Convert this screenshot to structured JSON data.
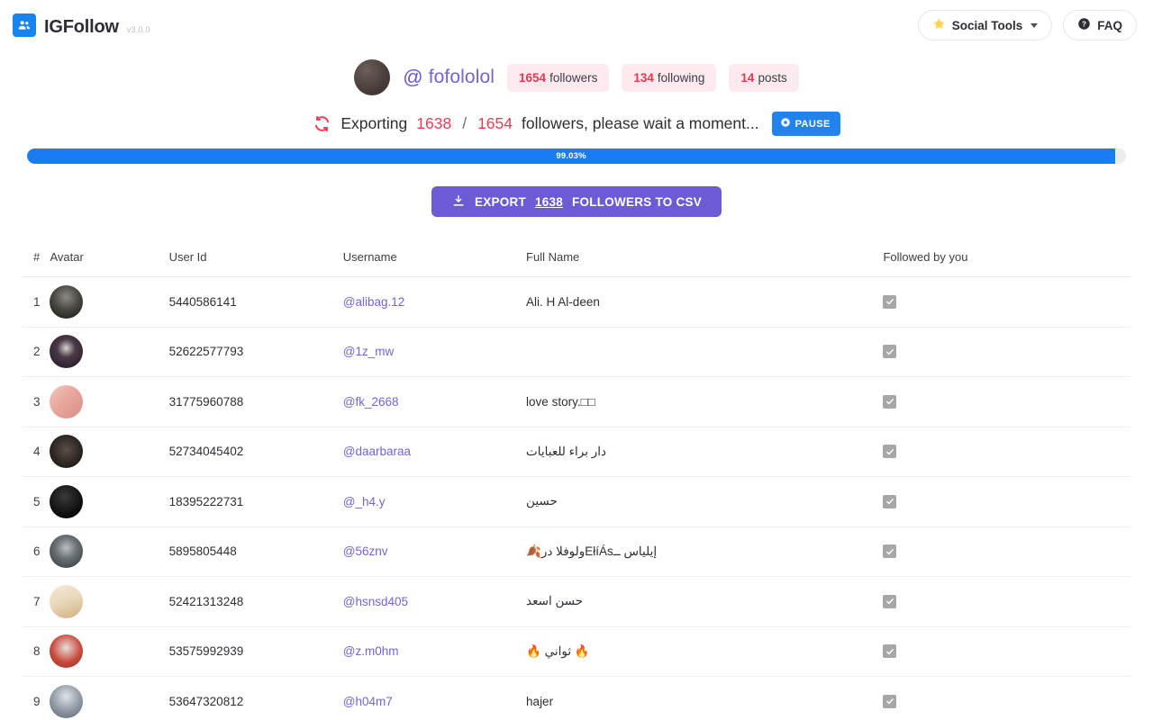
{
  "header": {
    "brand_name": "IGFollow",
    "version": "v3.0.0",
    "logo_icon": "people-icon",
    "social_tools_label": "Social Tools",
    "social_tools_icon": "star-icon",
    "social_tools_chevron": "chevron-down-icon",
    "faq_label": "FAQ",
    "faq_icon": "question-circle-icon"
  },
  "profile": {
    "avatar_icon": "user-avatar",
    "at_symbol": "@",
    "username": "fofololol",
    "stats": [
      {
        "value": "1654",
        "label": "followers"
      },
      {
        "value": "134",
        "label": "following"
      },
      {
        "value": "14",
        "label": "posts"
      }
    ]
  },
  "status": {
    "sync_icon": "sync-spinner-icon",
    "prefix": "Exporting",
    "current": "1638",
    "separator": "/",
    "total": "1654",
    "suffix": "followers, please wait a moment...",
    "pause_label": "PAUSE",
    "pause_icon": "pause-circle-icon"
  },
  "progress": {
    "percent_label": "99.03%",
    "percent_value": 99.03,
    "fill_color": "#1a7cf0",
    "track_color": "#ececf0"
  },
  "export": {
    "icon": "download-icon",
    "prefix": "EXPORT",
    "count": "1638",
    "suffix": "FOLLOWERS TO CSV",
    "color": "#6c5bd4"
  },
  "table": {
    "columns": [
      "#",
      "Avatar",
      "User Id",
      "Username",
      "Full Name",
      "Followed by you"
    ],
    "rows": [
      {
        "idx": "1",
        "avatar": "av1",
        "user_id": "5440586141",
        "username": "@alibag.12",
        "full_name": "Ali. H Al-deen",
        "followed": true
      },
      {
        "idx": "2",
        "avatar": "av2",
        "user_id": "52622577793",
        "username": "@1z_mw",
        "full_name": "",
        "followed": true
      },
      {
        "idx": "3",
        "avatar": "av3",
        "user_id": "31775960788",
        "username": "@fk_2668",
        "full_name": "love story.□□",
        "followed": true
      },
      {
        "idx": "4",
        "avatar": "av4",
        "user_id": "52734045402",
        "username": "@daarbaraa",
        "full_name": "دار براء للعبايات",
        "followed": true
      },
      {
        "idx": "5",
        "avatar": "av5",
        "user_id": "18395222731",
        "username": "@_h4.y",
        "full_name": "حسين",
        "followed": true
      },
      {
        "idx": "6",
        "avatar": "av6",
        "user_id": "5895805448",
        "username": "@56znv",
        "full_name": "إيلياس ـ‌‌ـEłíÁsو‌لوفلا در🍂",
        "followed": true
      },
      {
        "idx": "7",
        "avatar": "av7",
        "user_id": "52421313248",
        "username": "@hsnsd405",
        "full_name": "حسن اسعد",
        "followed": true
      },
      {
        "idx": "8",
        "avatar": "av8",
        "user_id": "53575992939",
        "username": "@z.m0hm",
        "full_name": "🔥 ثواني 🔥",
        "followed": true
      },
      {
        "idx": "9",
        "avatar": "av9",
        "user_id": "53647320812",
        "username": "@h04m7",
        "full_name": "hajer",
        "followed": true
      }
    ]
  }
}
